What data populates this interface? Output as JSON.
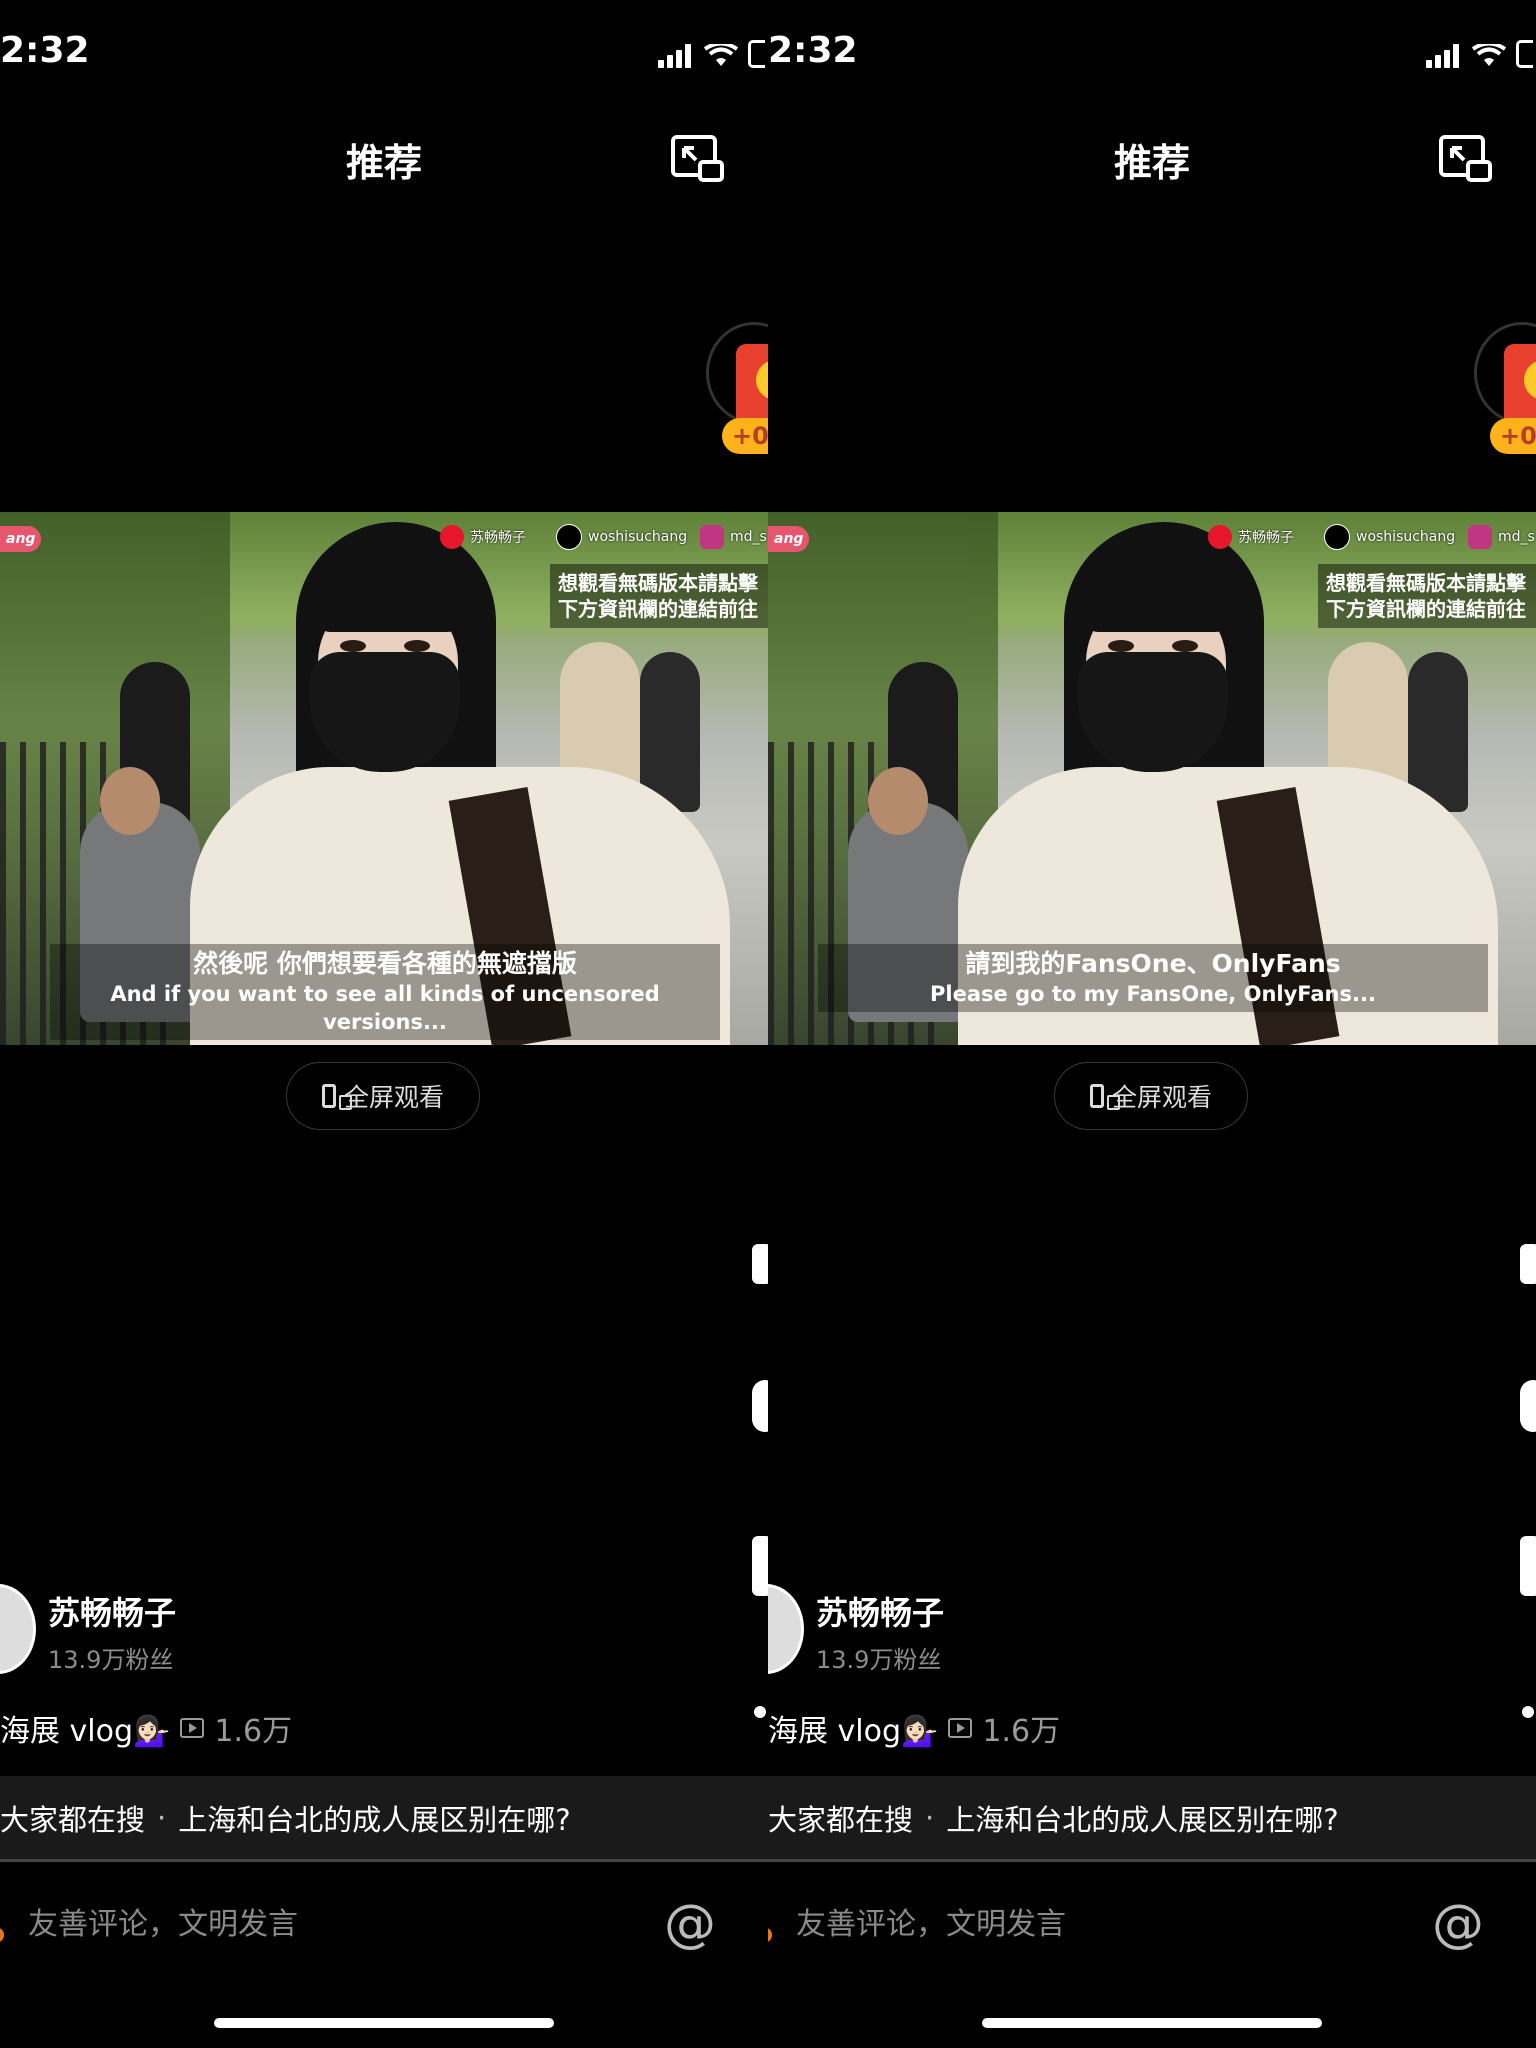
{
  "status": {
    "time": "2:32"
  },
  "header": {
    "title": "推荐"
  },
  "red_packet": {
    "badge": "+0."
  },
  "video": {
    "tag_left": "ang",
    "watermarks": [
      "苏畅畅子",
      "woshisuchang",
      "md_s"
    ],
    "promo_lines": [
      "想觀看無碼版本請點擊",
      "下方資訊欄的連結前往"
    ],
    "frames": [
      {
        "subtitle_cn": "然後呢 你們想要看各種的無遮擋版",
        "subtitle_en": "And if you want to see all kinds of uncensored versions..."
      },
      {
        "subtitle_cn": "請到我的FansOne、OnlyFans",
        "subtitle_en": "Please go to my FansOne, OnlyFans..."
      }
    ]
  },
  "fullscreen_label": "全屏观看",
  "author": {
    "name": "苏畅畅子",
    "fans": "13.9万粉丝"
  },
  "description": {
    "text": "海展 vlog💁🏻‍♀️",
    "views": "1.6万"
  },
  "search_suggest": {
    "prefix": "大家都在搜",
    "query": "上海和台北的成人展区别在哪?"
  },
  "comment": {
    "placeholder": "友善评论，文明发言"
  },
  "colors": {
    "background": "#000000",
    "badge": "#ffb21b",
    "red_packet": "#e8412f"
  }
}
